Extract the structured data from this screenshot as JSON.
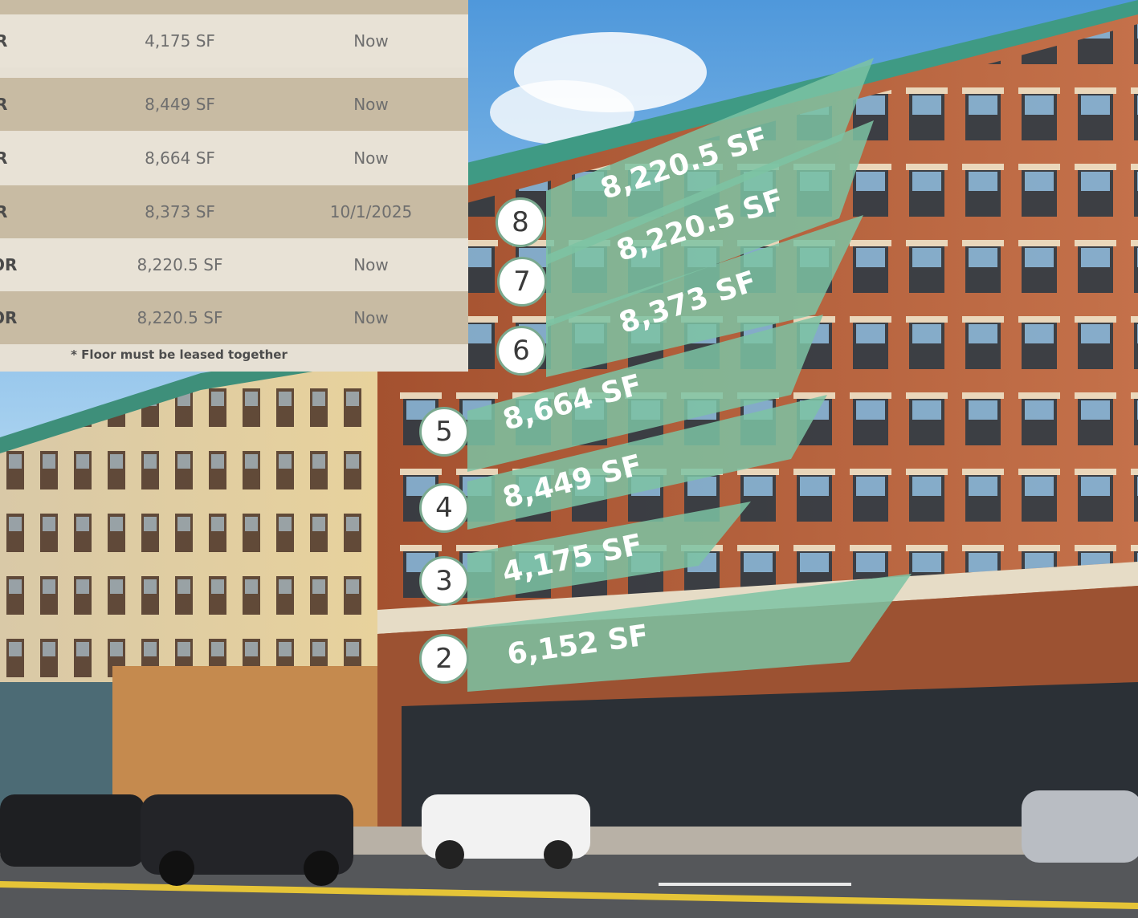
{
  "availability_table": {
    "rows": [
      {
        "floor": "OOR",
        "size": "4,175 SF",
        "available": "Now"
      },
      {
        "floor": "OOR",
        "size": "8,449 SF",
        "available": "Now"
      },
      {
        "floor": "OOR",
        "size": "8,664 SF",
        "available": "Now"
      },
      {
        "floor": "OOR",
        "size": "8,373 SF",
        "available": "10/1/2025"
      },
      {
        "floor": "LOOR",
        "size": "8,220.5 SF",
        "available": "Now"
      },
      {
        "floor": "LOOR",
        "size": "8,220.5 SF",
        "available": "Now"
      }
    ],
    "note": "* Floor must be leased together"
  },
  "floor_overlays": [
    {
      "floor": "8",
      "size": "8,220.5 SF"
    },
    {
      "floor": "7",
      "size": "8,220.5 SF"
    },
    {
      "floor": "6",
      "size": "8,373 SF"
    },
    {
      "floor": "5",
      "size": "8,664 SF"
    },
    {
      "floor": "4",
      "size": "8,449 SF"
    },
    {
      "floor": "3",
      "size": "4,175 SF"
    },
    {
      "floor": "2",
      "size": "6,152 SF"
    }
  ],
  "colors": {
    "overlay_green": "#7cc3a3",
    "badge_border": "#7aa98f",
    "table_light": "#e8e2d6",
    "table_dark": "#c8bba3",
    "brick": "#b9653f",
    "stone": "#e2cfa0",
    "sky": "#7fb9e6"
  }
}
